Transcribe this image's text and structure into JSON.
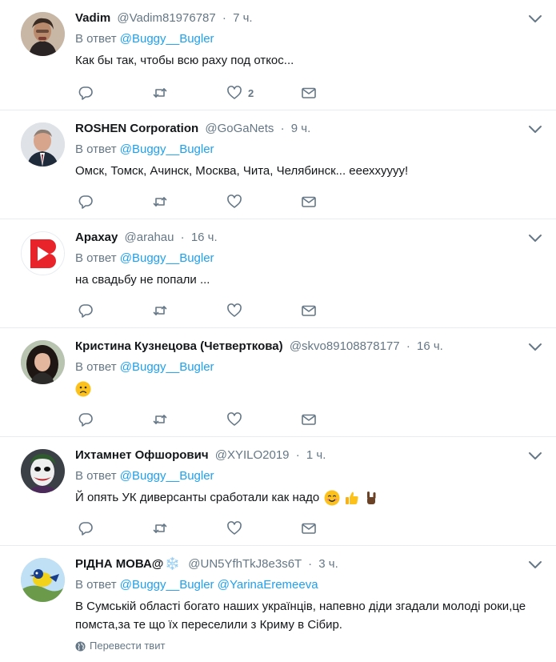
{
  "feed": {
    "tweets": [
      {
        "name": "Vadim",
        "handle": "@Vadim81976787",
        "time": "7 ч.",
        "reply_prefix": "В ответ",
        "mention1": "@Buggy__Bugler",
        "text": "Как бы так, чтобы всю раху под откос...",
        "like_count": "2"
      },
      {
        "name": "ROSHEN Corporation",
        "handle": "@GoGaNets",
        "time": "9 ч.",
        "reply_prefix": "В ответ",
        "mention1": "@Buggy__Bugler",
        "text": "Омск, Томск, Ачинск, Москва, Чита, Челябинск... еееххуууу!"
      },
      {
        "name": "Арахау",
        "handle": "@arahau",
        "time": "16 ч.",
        "reply_prefix": "В ответ",
        "mention1": "@Buggy__Bugler",
        "text": "на свадьбу не попали ..."
      },
      {
        "name": "Кристина Кузнецова (Четверткова)",
        "handle": "@skvo89108878177",
        "time": "16 ч.",
        "reply_prefix": "В ответ",
        "mention1": "@Buggy__Bugler"
      },
      {
        "name": "Ихтамнет Офшорович",
        "handle": "@XYILO2019",
        "time": "1 ч.",
        "reply_prefix": "В ответ",
        "mention1": "@Buggy__Bugler",
        "text": "Й опять УК диверсанты сработали как надо"
      },
      {
        "name": "РІДНА МОВА@",
        "name_emoji": "❄️",
        "handle": "@UN5YfhTkJ8e3s6T",
        "time": "3 ч.",
        "reply_prefix": "В ответ",
        "mention1": "@Buggy__Bugler",
        "mention2": "@YarinaEremeeva",
        "text": "В Сумській області богато наших українців, напевно діди згадали молоді роки,це помста,за те що їх переселили з Криму в Сібир.",
        "translate": "Перевести твит"
      }
    ]
  },
  "colors": {
    "link": "#1da1f2",
    "muted": "#657786",
    "text": "#14171a",
    "divider": "#e6ecf0"
  },
  "icons": [
    "chevron-down-icon",
    "reply-icon",
    "retweet-icon",
    "heart-icon",
    "envelope-icon",
    "globe-icon"
  ]
}
